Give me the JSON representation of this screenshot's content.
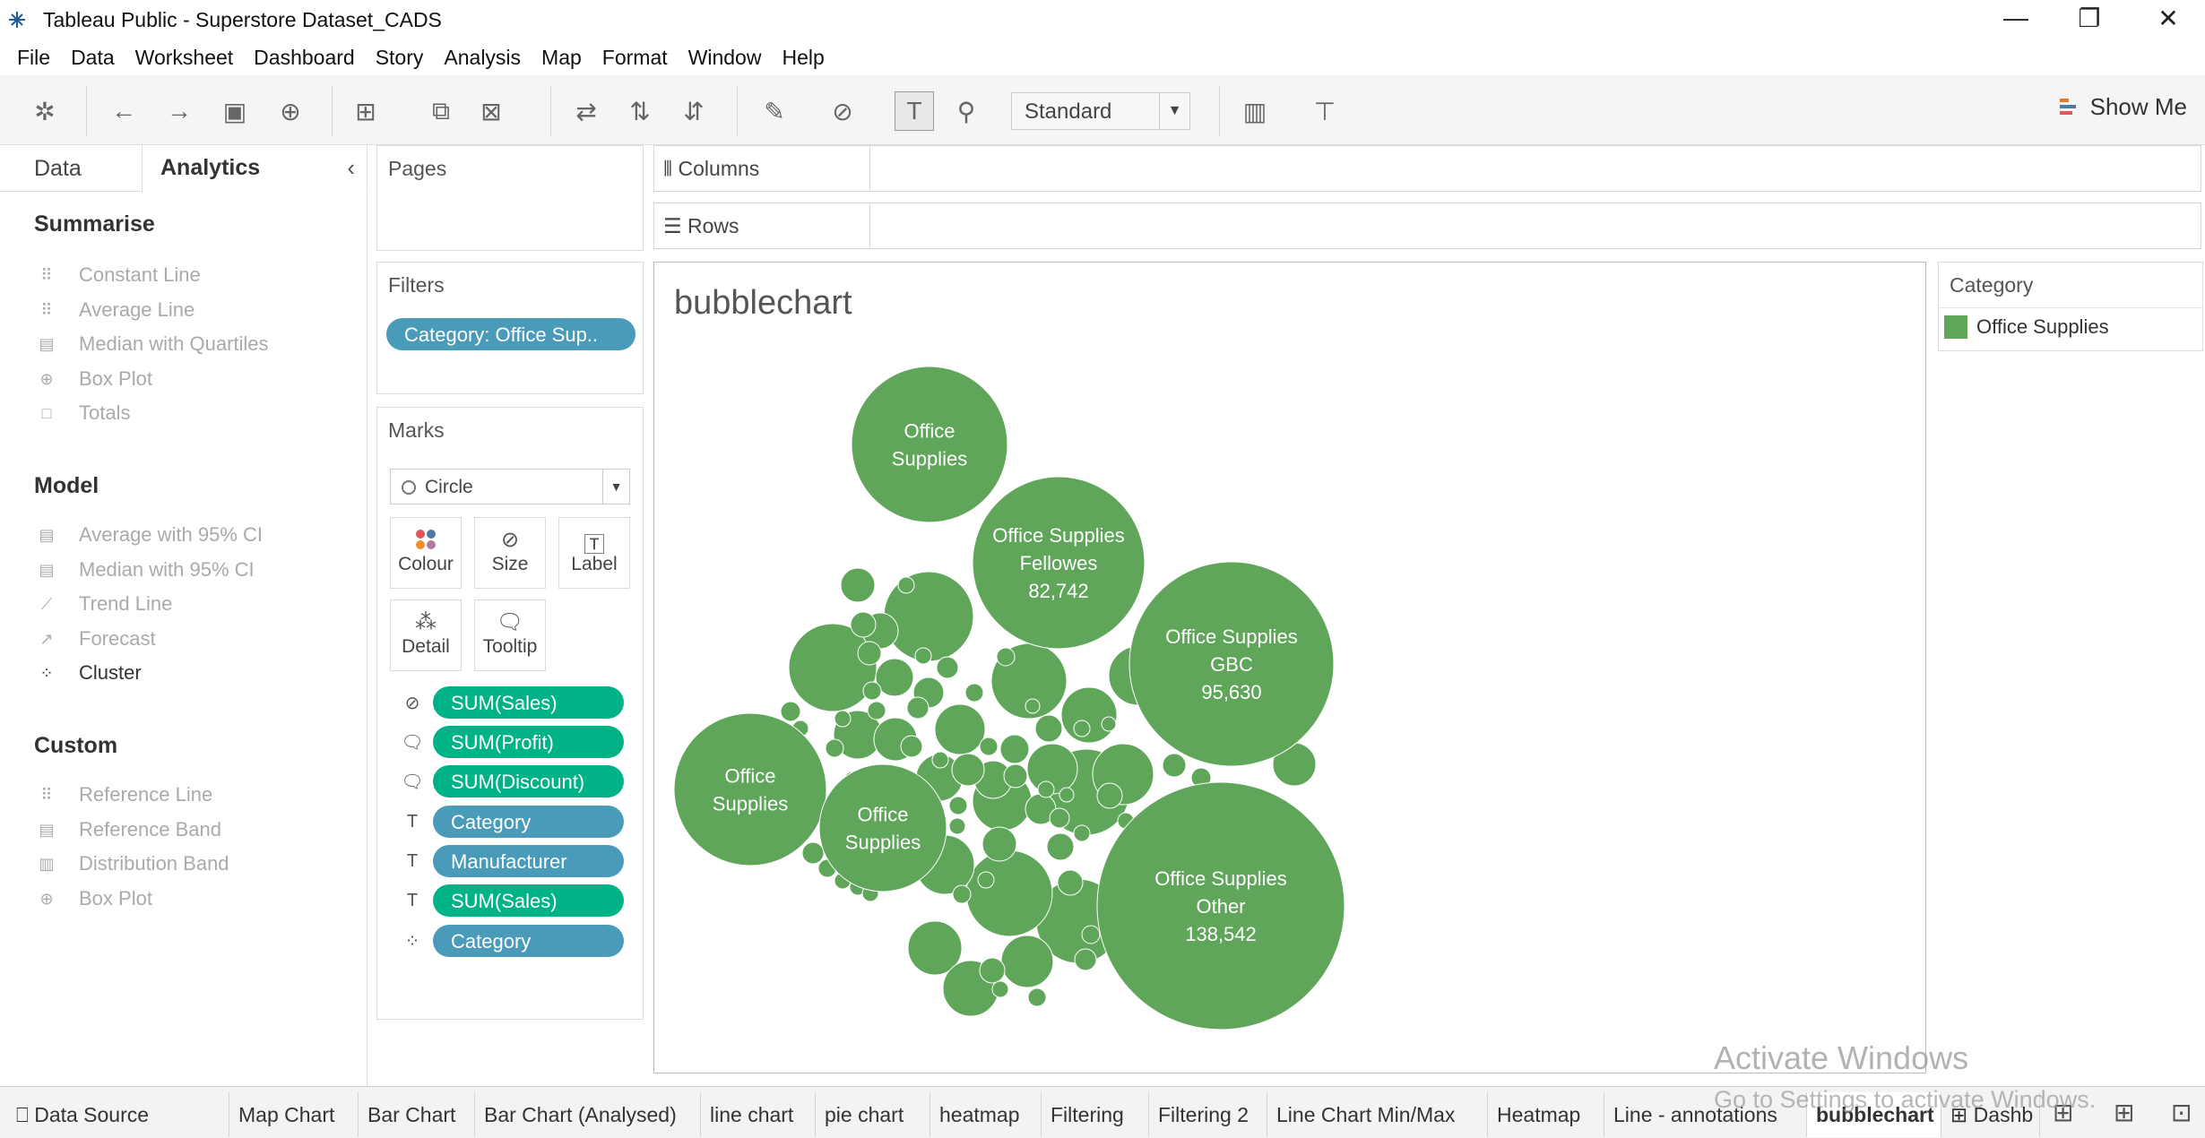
{
  "window": {
    "title": "Tableau Public - Superstore Dataset_CADS"
  },
  "menu": [
    "File",
    "Data",
    "Worksheet",
    "Dashboard",
    "Story",
    "Analysis",
    "Map",
    "Format",
    "Window",
    "Help"
  ],
  "toolbar": {
    "mark_size_select": "Standard",
    "show_me": "Show Me"
  },
  "left_tabs": {
    "data": "Data",
    "analytics": "Analytics"
  },
  "analytics": {
    "summarise": {
      "title": "Summarise",
      "items": [
        "Constant Line",
        "Average Line",
        "Median with Quartiles",
        "Box Plot",
        "Totals"
      ]
    },
    "model": {
      "title": "Model",
      "items": [
        "Average with 95% CI",
        "Median with 95% CI",
        "Trend Line",
        "Forecast",
        "Cluster"
      ]
    },
    "custom": {
      "title": "Custom",
      "items": [
        "Reference Line",
        "Reference Band",
        "Distribution Band",
        "Box Plot"
      ]
    }
  },
  "pages": {
    "title": "Pages"
  },
  "filters": {
    "title": "Filters",
    "pill": "Category: Office Sup.."
  },
  "marks": {
    "title": "Marks",
    "type": "Circle",
    "buttons": [
      "Colour",
      "Size",
      "Label",
      "Detail",
      "Tooltip"
    ],
    "pills": [
      {
        "label": "SUM(Sales)",
        "color": "green",
        "icon": "size-icon"
      },
      {
        "label": "SUM(Profit)",
        "color": "green",
        "icon": "tooltip-icon"
      },
      {
        "label": "SUM(Discount)",
        "color": "green",
        "icon": "tooltip-icon"
      },
      {
        "label": "Category",
        "color": "blue",
        "icon": "label-icon"
      },
      {
        "label": "Manufacturer",
        "color": "blue",
        "icon": "label-icon"
      },
      {
        "label": "SUM(Sales)",
        "color": "green",
        "icon": "label-icon"
      },
      {
        "label": "Category",
        "color": "blue",
        "icon": "colour-icon"
      }
    ]
  },
  "shelves": {
    "columns": "Columns",
    "rows": "Rows"
  },
  "viz": {
    "title": "bubblechart"
  },
  "legend": {
    "title": "Category",
    "item": "Office Supplies",
    "color": "#5fa55a"
  },
  "chart_data": {
    "type": "bubble",
    "title": "bubblechart",
    "color": "#5fa55a",
    "labeled_bubbles": [
      {
        "category": "Office Supplies",
        "manufacturer": "Other",
        "sales": 138542
      },
      {
        "category": "Office Supplies",
        "manufacturer": "GBC",
        "sales": 95630
      },
      {
        "category": "Office Supplies",
        "manufacturer": "Fellowes",
        "sales": 82742
      },
      {
        "category": "Office Supplies"
      },
      {
        "category": "Office Supplies"
      },
      {
        "category": "Office Supplies"
      }
    ]
  },
  "sheet_tabs": [
    "Data Source",
    "Map Chart",
    "Bar Chart",
    "Bar Chart (Analysed)",
    "line chart",
    "pie chart",
    "heatmap",
    "Filtering",
    "Filtering 2",
    "Line Chart Min/Max",
    "Heatmap",
    "Line - annotations",
    "bubblechart",
    "Dashb"
  ],
  "active_sheet": "bubblechart",
  "watermark": {
    "line1": "Activate Windows",
    "line2": "Go to Settings to activate Windows."
  }
}
